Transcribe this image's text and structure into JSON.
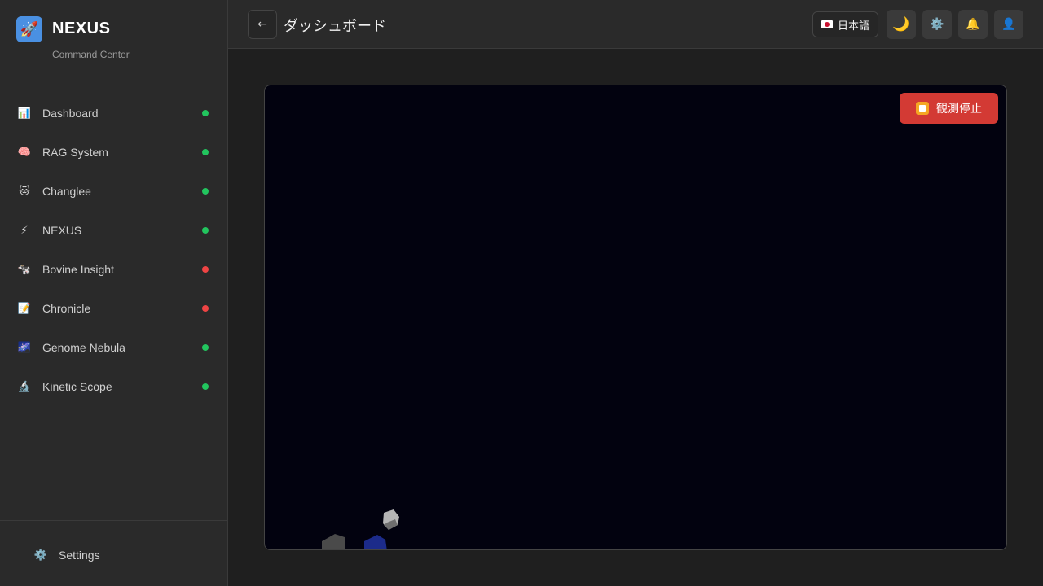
{
  "brand": {
    "title": "NEXUS",
    "subtitle": "Command Center",
    "logo_icon": "rocket-icon",
    "logo_color": "#4a90e2"
  },
  "sidebar": {
    "items": [
      {
        "label": "Dashboard",
        "icon": "bar-chart-icon",
        "glyph": "📊",
        "status": "online"
      },
      {
        "label": "RAG System",
        "icon": "brain-icon",
        "glyph": "🧠",
        "status": "online"
      },
      {
        "label": "Changlee",
        "icon": "cat-icon",
        "glyph": "🐱",
        "status": "online"
      },
      {
        "label": "NEXUS",
        "icon": "lightning-icon",
        "glyph": "⚡",
        "status": "online"
      },
      {
        "label": "Bovine Insight",
        "icon": "cow-icon",
        "glyph": "🐄",
        "status": "offline"
      },
      {
        "label": "Chronicle",
        "icon": "memo-icon",
        "glyph": "📝",
        "status": "offline"
      },
      {
        "label": "Genome Nebula",
        "icon": "galaxy-icon",
        "glyph": "🌌",
        "status": "online"
      },
      {
        "label": "Kinetic Scope",
        "icon": "microscope-icon",
        "glyph": "🔬",
        "status": "online"
      }
    ],
    "footer": {
      "label": "Settings",
      "icon": "gear-icon",
      "glyph": "⚙️"
    }
  },
  "status_colors": {
    "online": "#22c55e",
    "offline": "#ef4444"
  },
  "header": {
    "back_glyph": "←",
    "title": "ダッシュボード",
    "language": "日本語",
    "theme_glyph": "🌙",
    "settings_glyph": "⚙️",
    "notifications_glyph": "🔔",
    "profile_glyph": "👤"
  },
  "main": {
    "stop_button_label": "観測停止",
    "canvas_background": "#02020f"
  }
}
